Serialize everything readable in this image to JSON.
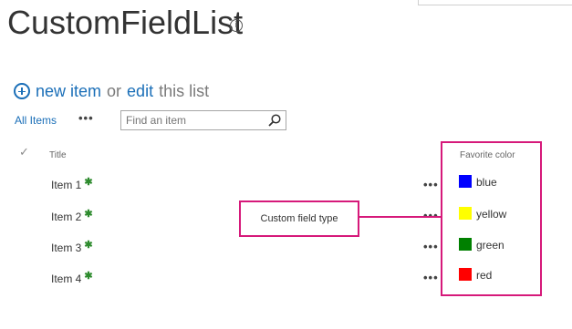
{
  "page": {
    "title": "CustomFieldList"
  },
  "command_bar": {
    "new_item": "new item",
    "or": "or",
    "edit": "edit",
    "this_list": "this list"
  },
  "view": {
    "all_items": "All Items",
    "more": "•••",
    "search_placeholder": "Find an item"
  },
  "list": {
    "checkmark": "✓",
    "title_header": "Title",
    "favorite_header": "Favorite color",
    "row_menu": "•••",
    "rows": [
      {
        "title": "Item 1",
        "color_name": "blue",
        "color_hex": "#0000ff"
      },
      {
        "title": "Item 2",
        "color_name": "yellow",
        "color_hex": "#ffff00"
      },
      {
        "title": "Item 3",
        "color_name": "green",
        "color_hex": "#008000"
      },
      {
        "title": "Item 4",
        "color_name": "red",
        "color_hex": "#ff0000"
      }
    ],
    "new_marker": "✱"
  },
  "annotation": {
    "callout_text": "Custom field type",
    "highlight_color": "#d6197a"
  }
}
